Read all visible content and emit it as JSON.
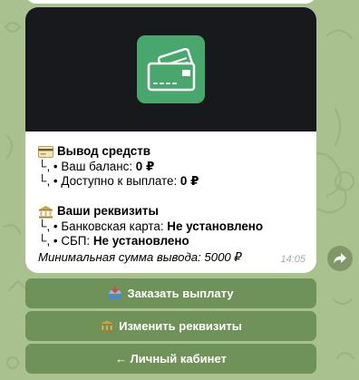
{
  "chat": {
    "message": {
      "withdraw_title": "Вывод средств",
      "balance_label": "Ваш баланс: ",
      "balance_value": "0 ₽",
      "available_label": "Доступно к выплате: ",
      "available_value": "0 ₽",
      "requisites_title": "Ваши реквизиты",
      "bank_card_label": "Банковская карта: ",
      "bank_card_value": "Не установлено",
      "sbp_label": "СБП: ",
      "sbp_value": "Не установлено",
      "branch_prefix": "└, • ",
      "min_sum": "Минимальная сумма вывода: 5000 ₽",
      "time": "14:05"
    }
  },
  "keyboard": {
    "buttons": [
      {
        "label": "Заказать выплату",
        "icon": "inbox-tray-icon"
      },
      {
        "label": "Изменить реквизиты",
        "icon": "bank-icon"
      },
      {
        "label": "← Личный кабинет",
        "icon": null
      }
    ]
  },
  "colors": {
    "accent": "#48a76c",
    "background": "#a9c18e",
    "media_bg": "#17191c",
    "keyboard_button": "#5f8a4d"
  }
}
